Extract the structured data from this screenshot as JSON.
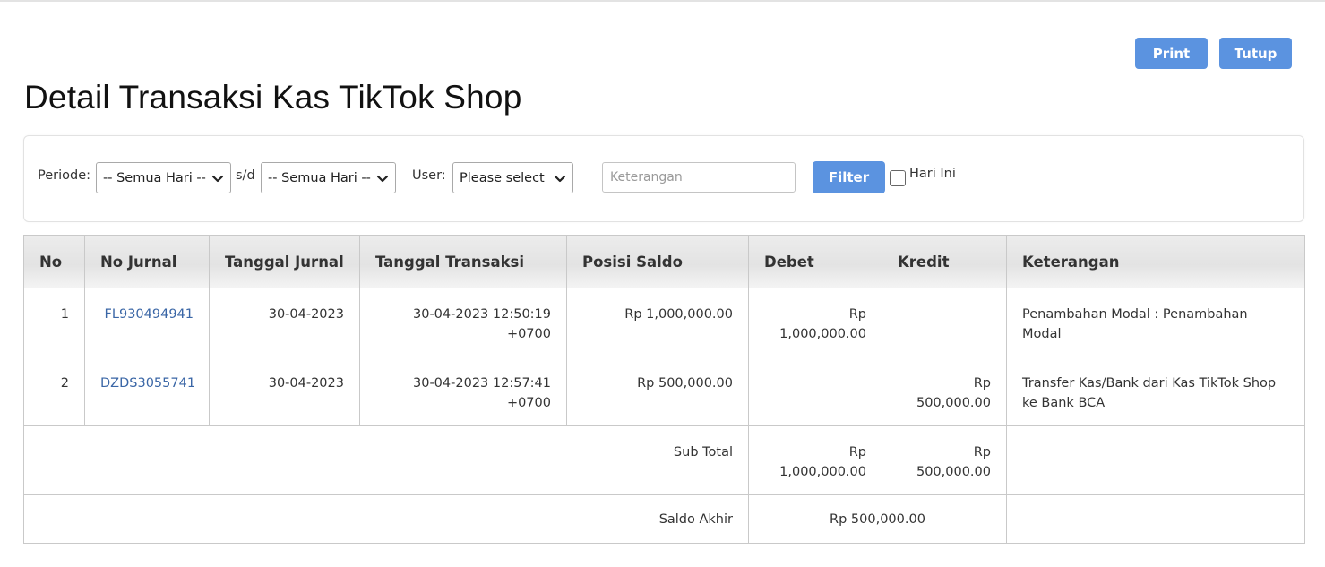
{
  "header": {
    "title": "Detail Transaksi Kas TikTok Shop",
    "print_label": "Print",
    "close_label": "Tutup"
  },
  "filter": {
    "periode_label": "Periode:",
    "periode_from": "-- Semua Hari --",
    "separator": "s/d",
    "periode_to": "-- Semua Hari --",
    "user_label": "User:",
    "user_value": "Please select",
    "keterangan_placeholder": "Keterangan",
    "filter_label": "Filter",
    "hari_ini_label": "Hari Ini",
    "hari_ini_checked": false
  },
  "table": {
    "columns": [
      "No",
      "No Jurnal",
      "Tanggal Jurnal",
      "Tanggal Transaksi",
      "Posisi Saldo",
      "Debet",
      "Kredit",
      "Keterangan"
    ],
    "rows": [
      {
        "no": "1",
        "no_jurnal": "FL930494941",
        "tanggal_jurnal": "30-04-2023",
        "tanggal_transaksi_1": "30-04-2023 12:50:19",
        "tanggal_transaksi_2": "+0700",
        "posisi_saldo": "Rp 1,000,000.00",
        "debet_1": "Rp",
        "debet_2": "1,000,000.00",
        "kredit_1": "",
        "kredit_2": "",
        "keterangan_1": "Penambahan Modal : Penambahan Modal",
        "keterangan_2": ""
      },
      {
        "no": "2",
        "no_jurnal": "DZDS3055741",
        "tanggal_jurnal": "30-04-2023",
        "tanggal_transaksi_1": "30-04-2023 12:57:41",
        "tanggal_transaksi_2": "+0700",
        "posisi_saldo": "Rp 500,000.00",
        "debet_1": "",
        "debet_2": "",
        "kredit_1": "Rp",
        "kredit_2": "500,000.00",
        "keterangan_1": "Transfer Kas/Bank dari Kas TikTok Shop",
        "keterangan_2": "ke Bank BCA"
      }
    ],
    "subtotal": {
      "label": "Sub Total",
      "debet_1": "Rp",
      "debet_2": "1,000,000.00",
      "kredit_1": "Rp",
      "kredit_2": "500,000.00"
    },
    "saldo_akhir": {
      "label": "Saldo Akhir",
      "value": "Rp 500,000.00"
    }
  }
}
